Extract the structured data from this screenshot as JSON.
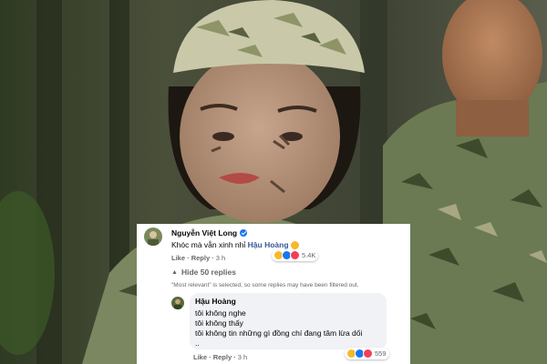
{
  "comment_main": {
    "author": "Nguyễn Việt Long",
    "text": "Khóc mà vẫn xinh nhỉ",
    "mention": "Hậu Hoàng",
    "like_label": "Like",
    "reply_label": "Reply",
    "time": "3 h",
    "reaction_count": "5.4K"
  },
  "replies_toggle": {
    "label": "Hide 50 replies",
    "note": "\"Most relevant\" is selected, so some replies may have been filtered out."
  },
  "reply": {
    "author": "Hậu Hoàng",
    "lines": [
      "tôi không nghe",
      "tôi không thấy",
      "tôi không tin những gì đồng chí đang tâm lừa dối",
      ".."
    ],
    "like_label": "Like",
    "reply_label": "Reply",
    "time": "3 h",
    "reaction_count": "559"
  },
  "icons": {
    "verified": "verified-badge-icon",
    "toggle": "chevron-up-icon",
    "emoji": "laughing-emoji-icon"
  },
  "colors": {
    "link": "#385898",
    "muted": "#65676b",
    "bubble": "#f0f2f5",
    "verified": "#1877f2"
  }
}
